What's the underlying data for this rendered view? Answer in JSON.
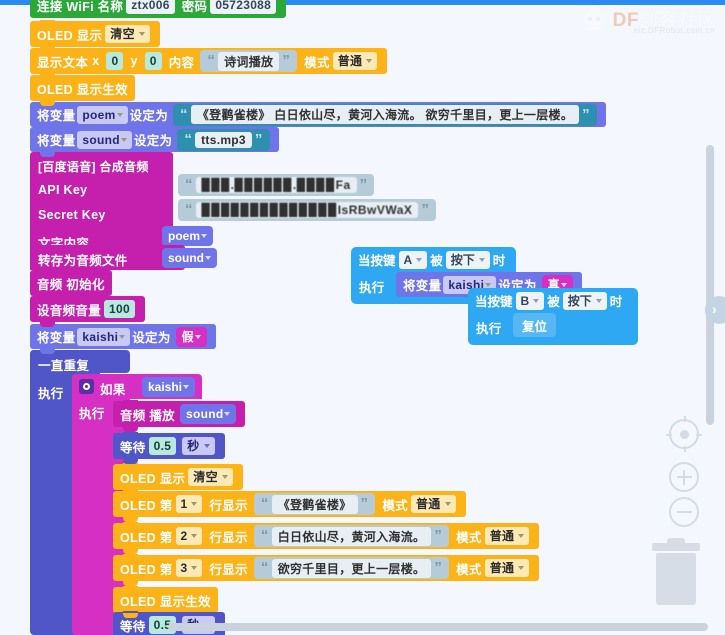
{
  "watermark": {
    "brand": "DF",
    "name": "创客社区",
    "url": "mc.DFRobot.com.cn"
  },
  "blocks": {
    "wifi": {
      "label": "连接 WiFi 名称",
      "ssid": "ztx006",
      "password_label": "密码",
      "password": "05723088"
    },
    "oled_clear_1": {
      "label": "OLED 显示",
      "mode": "清空"
    },
    "show_text": {
      "label": "显示文本",
      "x_label": "x",
      "x": "0",
      "y_label": "y",
      "y": "0",
      "content_label": "内容",
      "content": "诗词播放",
      "mode_label": "模式",
      "mode": "普通"
    },
    "oled_apply_1": {
      "label": "OLED 显示生效"
    },
    "set_poem": {
      "label": "将变量",
      "var": "poem",
      "to_label": "设定为",
      "value": "《登鹳雀楼》  白日依山尽，黄河入海流。 欲穷千里目，更上一层楼。"
    },
    "set_sound": {
      "label": "将变量",
      "var": "sound",
      "to_label": "设定为",
      "value": "tts.mp3"
    },
    "baidu": {
      "title": "[百度语音] 合成音频",
      "api_key_label": "API Key",
      "api_key_value": "▉▉▉.▉▉▉▉▉▉.▉▉▉▉Fa",
      "secret_key_label": "Secret Key",
      "secret_key_value": "▉▉▉▉▉▉▉▉▉▉▉▉▉▉IsRBwVWaX",
      "text_label": "文字内容",
      "text_var": "poem",
      "save_label": "转存为音频文件",
      "save_var": "sound"
    },
    "audio_init": {
      "label": "音频 初始化"
    },
    "audio_volume": {
      "label": "设音频音量",
      "value": "100"
    },
    "set_kaishi": {
      "label": "将变量",
      "var": "kaishi",
      "to_label": "设定为",
      "value": "假"
    },
    "forever": {
      "label": "一直重复",
      "do_label": "执行"
    },
    "if_block": {
      "label": "如果",
      "condition_var": "kaishi",
      "do_label": "执行"
    },
    "audio_play": {
      "label": "音频 播放",
      "var": "sound"
    },
    "wait_1": {
      "label": "等待",
      "value": "0.5",
      "unit": "秒"
    },
    "oled_clear_2": {
      "label": "OLED 显示",
      "mode": "清空"
    },
    "oled_line_1": {
      "prefix": "OLED 第",
      "line": "1",
      "mid": "行显示",
      "text": "《登鹳雀楼》",
      "mode_label": "模式",
      "mode": "普通"
    },
    "oled_line_2": {
      "prefix": "OLED 第",
      "line": "2",
      "mid": "行显示",
      "text": "白日依山尽，黄河入海流。",
      "mode_label": "模式",
      "mode": "普通"
    },
    "oled_line_3": {
      "prefix": "OLED 第",
      "line": "3",
      "mid": "行显示",
      "text": "欲穷千里目，更上一层楼。",
      "mode_label": "模式",
      "mode": "普通"
    },
    "oled_apply_2": {
      "label": "OLED 显示生效"
    },
    "wait_2": {
      "label": "等待",
      "value": "0.5",
      "unit": "秒"
    },
    "event_a": {
      "prefix": "当按键",
      "key": "A",
      "mid": "被",
      "action": "按下",
      "suffix": "时",
      "do_label": "执行",
      "body_label": "将变量",
      "body_var": "kaishi",
      "body_to": "设定为",
      "body_value": "真"
    },
    "event_b": {
      "prefix": "当按键",
      "key": "B",
      "mid": "被",
      "action": "按下",
      "suffix": "时",
      "do_label": "执行",
      "body_label": "复位"
    }
  },
  "controls": {
    "center_icon": "crosshair-target-icon",
    "zoom_in": "+",
    "zoom_out": "−",
    "trash_icon": "trash-can-icon"
  }
}
